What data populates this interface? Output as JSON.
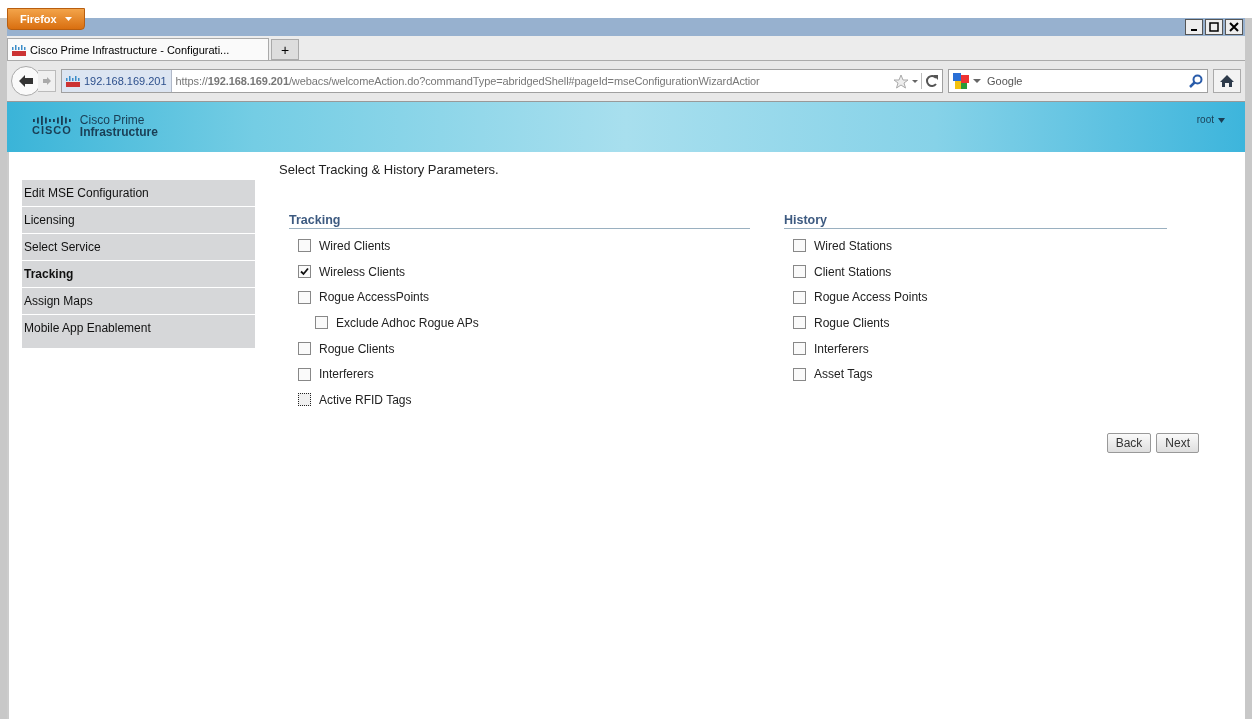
{
  "browser": {
    "menu_button": "Firefox",
    "tab": {
      "title": "Cisco Prime Infrastructure - Configurati...",
      "selected": true
    },
    "new_tab": "+",
    "site_identity": "192.168.169.201",
    "url": "https://**192.168.169.201**/webacs/welcomeAction.do?commandType=abridgedShell#pageId=mseConfigurationWizardActior",
    "search": {
      "placeholder": "Google"
    }
  },
  "header": {
    "brand_top": "Cisco Prime",
    "brand_bottom": "Infrastructure",
    "logo_word": "CISCO",
    "user": "root"
  },
  "sidebar": {
    "items": [
      {
        "label": "Edit MSE Configuration",
        "selected": false
      },
      {
        "label": "Licensing",
        "selected": false
      },
      {
        "label": "Select Service",
        "selected": false
      },
      {
        "label": "Tracking",
        "selected": true
      },
      {
        "label": "Assign Maps",
        "selected": false
      },
      {
        "label": "Mobile App Enablement",
        "selected": false
      }
    ]
  },
  "page_title": "Select Tracking & History Parameters.",
  "sections": [
    {
      "title": "Tracking",
      "options": [
        {
          "label": "Wired Clients",
          "checked": false
        },
        {
          "label": "Wireless Clients",
          "checked": true
        },
        {
          "label": "Rogue AccessPoints",
          "checked": false,
          "children": [
            {
              "label": "Exclude Adhoc Rogue APs",
              "checked": false
            }
          ]
        },
        {
          "label": "Rogue Clients",
          "checked": false
        },
        {
          "label": "Interferers",
          "checked": false
        },
        {
          "label": "Active RFID Tags",
          "checked": false,
          "focused": true
        }
      ]
    },
    {
      "title": "History",
      "options": [
        {
          "label": "Wired Stations",
          "checked": false
        },
        {
          "label": "Client Stations",
          "checked": false
        },
        {
          "label": "Rogue Access Points",
          "checked": false
        },
        {
          "label": "Rogue Clients",
          "checked": false
        },
        {
          "label": "Interferers",
          "checked": false
        },
        {
          "label": "Asset Tags",
          "checked": false
        }
      ]
    }
  ],
  "buttons": [
    "Back",
    "Next"
  ]
}
